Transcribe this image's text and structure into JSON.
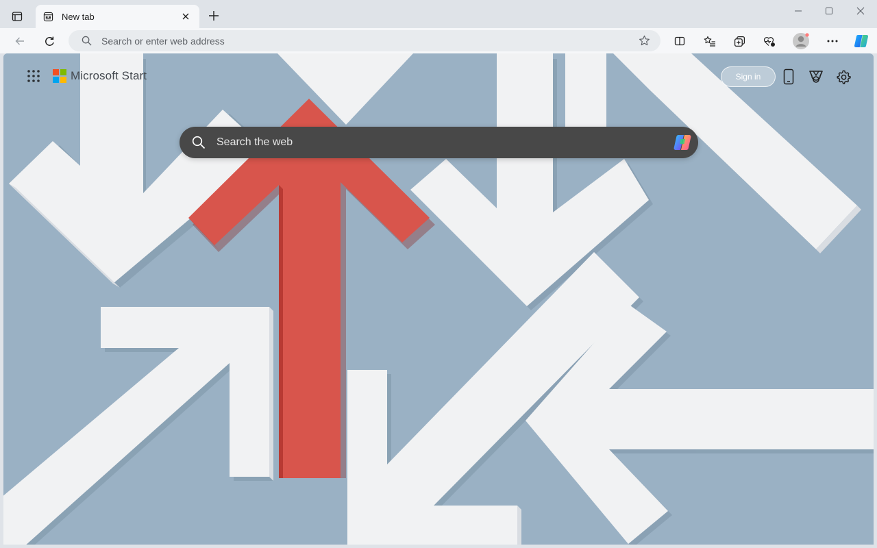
{
  "window": {
    "tab": {
      "title": "New tab",
      "favicon": "newtab-page-icon"
    },
    "controls": [
      "minimize-icon",
      "maximize-icon",
      "close-icon"
    ]
  },
  "toolbar": {
    "address_placeholder": "Search or enter web address",
    "address_value": ""
  },
  "page": {
    "brand": "Microsoft Start",
    "sign_in_label": "Sign in",
    "search_placeholder": "Search the web",
    "search_value": ""
  },
  "colors": {
    "background": "#9ab1c4",
    "arrow_red": "#d8554c",
    "arrow_white": "#f1f2f3",
    "search_box": "#484848",
    "ms_red": "#f25022",
    "ms_green": "#7fba00",
    "ms_blue": "#00a4ef",
    "ms_yellow": "#ffb900"
  }
}
